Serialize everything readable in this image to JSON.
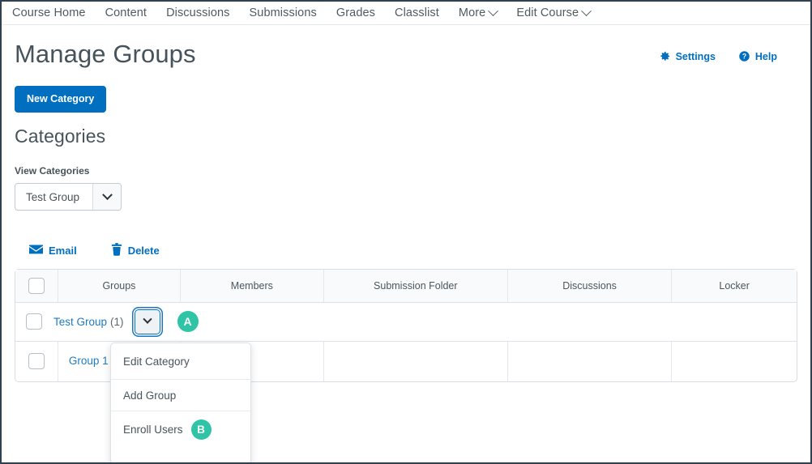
{
  "nav": {
    "items": [
      {
        "label": "Course Home",
        "caret": false
      },
      {
        "label": "Content",
        "caret": false
      },
      {
        "label": "Discussions",
        "caret": false
      },
      {
        "label": "Submissions",
        "caret": false
      },
      {
        "label": "Grades",
        "caret": false
      },
      {
        "label": "Classlist",
        "caret": false
      },
      {
        "label": "More",
        "caret": true
      },
      {
        "label": "Edit Course",
        "caret": true
      }
    ]
  },
  "header": {
    "title": "Manage Groups",
    "settings_label": "Settings",
    "help_label": "Help"
  },
  "actions": {
    "new_category_label": "New Category"
  },
  "categories": {
    "section_title": "Categories",
    "view_label": "View Categories",
    "selected": "Test Group"
  },
  "toolbar": {
    "email_label": "Email",
    "delete_label": "Delete"
  },
  "table": {
    "columns": [
      "Groups",
      "Members",
      "Submission Folder",
      "Discussions",
      "Locker"
    ],
    "category_row": {
      "name": "Test Group",
      "count": "(1)",
      "badge": "A"
    },
    "rows": [
      {
        "group": "Group 1",
        "members": "",
        "submission_folder": "",
        "discussions": "",
        "locker": ""
      }
    ]
  },
  "menu": {
    "items": [
      {
        "label": "Edit Category",
        "badge": ""
      },
      {
        "label": "Add Group",
        "badge": ""
      },
      {
        "label": "Enroll Users",
        "badge": "B"
      }
    ]
  },
  "colors": {
    "accent_blue": "#006fbf",
    "link_blue": "#1f7bc1",
    "badge_teal": "#2ec4a5",
    "text_dark": "#47535b",
    "border_gray": "#d8dee3"
  }
}
